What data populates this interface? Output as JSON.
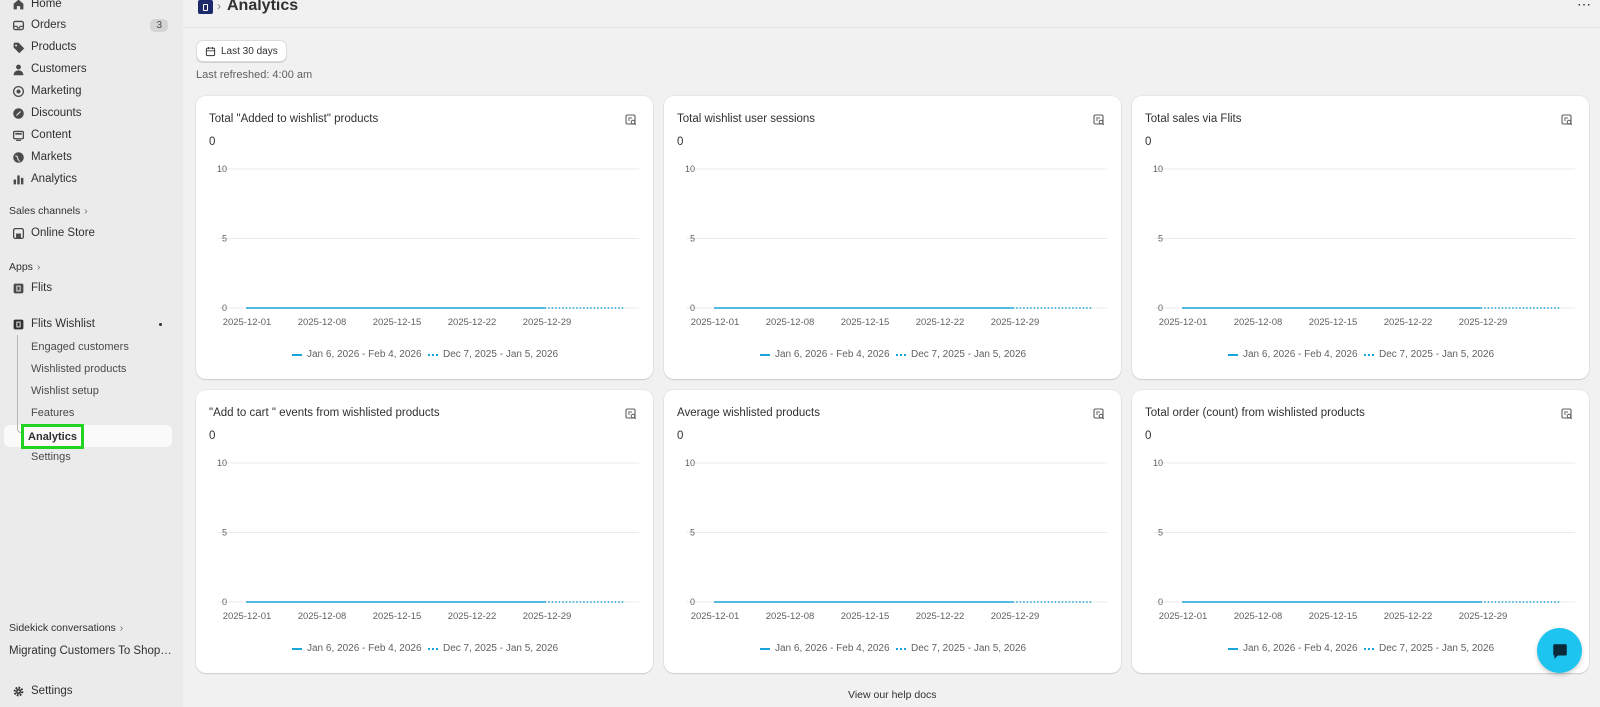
{
  "sidebar": {
    "items": [
      {
        "label": "Home",
        "icon": "home-icon"
      },
      {
        "label": "Orders",
        "icon": "orders-icon",
        "badge": "3"
      },
      {
        "label": "Products",
        "icon": "tag-icon"
      },
      {
        "label": "Customers",
        "icon": "person-icon"
      },
      {
        "label": "Marketing",
        "icon": "target-icon"
      },
      {
        "label": "Discounts",
        "icon": "discount-icon"
      },
      {
        "label": "Content",
        "icon": "content-icon"
      },
      {
        "label": "Markets",
        "icon": "globe-icon"
      },
      {
        "label": "Analytics",
        "icon": "bar-chart-icon"
      }
    ],
    "sales_channels_label": "Sales channels",
    "online_store_label": "Online Store",
    "apps_label": "Apps",
    "flits_label": "Flits",
    "flits_wishlist_label": "Flits Wishlist",
    "sub_items": [
      "Engaged customers",
      "Wishlisted products",
      "Wishlist setup",
      "Features",
      "Analytics",
      "Settings"
    ],
    "sidekick_label": "Sidekick conversations",
    "conversation_label": "Migrating Customers To Shopi...",
    "settings_label": "Settings"
  },
  "header": {
    "title": "Analytics",
    "more": "⋯"
  },
  "filters": {
    "date_range": "Last 30 days",
    "last_refreshed": "Last refreshed: 4:00 am"
  },
  "legend": {
    "current": "Jan 6, 2026 - Feb 4, 2026",
    "previous": "Dec 7, 2025 - Jan 5, 2026"
  },
  "cards": [
    {
      "title": "Total \"Added to wishlist\" products",
      "total": "0"
    },
    {
      "title": "Total wishlist user sessions",
      "total": "0"
    },
    {
      "title": "Total sales via Flits",
      "total": "0"
    },
    {
      "title": "\"Add to cart \" events from wishlisted products",
      "total": "0"
    },
    {
      "title": "Average wishlisted products",
      "total": "0"
    },
    {
      "title": "Total order (count) from wishlisted products",
      "total": "0"
    }
  ],
  "chart_data": [
    {
      "type": "line",
      "title": "Total \"Added to wishlist\" products",
      "x_ticks": [
        "2025-12-01",
        "2025-12-08",
        "2025-12-15",
        "2025-12-22",
        "2025-12-29"
      ],
      "y_ticks": [
        "0",
        "5",
        "10"
      ],
      "ylim": [
        0,
        10
      ],
      "series": [
        {
          "name": "Jan 6, 2026 - Feb 4, 2026",
          "style": "solid",
          "values": [
            0,
            0,
            0,
            0,
            0,
            0,
            0,
            0,
            0,
            0,
            0,
            0,
            0,
            0,
            0,
            0,
            0,
            0,
            0,
            0,
            0,
            0,
            0,
            0,
            0,
            0,
            0,
            0,
            0,
            0
          ]
        },
        {
          "name": "Dec 7, 2025 - Jan 5, 2026",
          "style": "dotted",
          "values": [
            0,
            0,
            0,
            0,
            0,
            0,
            0,
            0,
            0,
            0,
            0,
            0,
            0,
            0,
            0,
            0,
            0,
            0,
            0,
            0,
            0,
            0,
            0,
            0,
            0,
            0,
            0,
            0,
            0,
            0
          ]
        }
      ],
      "grid": true,
      "color": "#1ba4d9"
    },
    {
      "type": "line",
      "title": "Total wishlist user sessions",
      "x_ticks": [
        "2025-12-01",
        "2025-12-08",
        "2025-12-15",
        "2025-12-22",
        "2025-12-29"
      ],
      "y_ticks": [
        "0",
        "5",
        "10"
      ],
      "ylim": [
        0,
        10
      ],
      "series": [
        {
          "name": "Jan 6, 2026 - Feb 4, 2026",
          "style": "solid",
          "values": [
            0,
            0,
            0,
            0,
            0,
            0,
            0,
            0,
            0,
            0,
            0,
            0,
            0,
            0,
            0,
            0,
            0,
            0,
            0,
            0,
            0,
            0,
            0,
            0,
            0,
            0,
            0,
            0,
            0,
            0
          ]
        },
        {
          "name": "Dec 7, 2025 - Jan 5, 2026",
          "style": "dotted",
          "values": [
            0,
            0,
            0,
            0,
            0,
            0,
            0,
            0,
            0,
            0,
            0,
            0,
            0,
            0,
            0,
            0,
            0,
            0,
            0,
            0,
            0,
            0,
            0,
            0,
            0,
            0,
            0,
            0,
            0,
            0
          ]
        }
      ],
      "grid": true,
      "color": "#1ba4d9"
    },
    {
      "type": "line",
      "title": "Total sales via Flits",
      "x_ticks": [
        "2025-12-01",
        "2025-12-08",
        "2025-12-15",
        "2025-12-22",
        "2025-12-29"
      ],
      "y_ticks": [
        "0",
        "5",
        "10"
      ],
      "ylim": [
        0,
        10
      ],
      "series": [
        {
          "name": "Jan 6, 2026 - Feb 4, 2026",
          "style": "solid",
          "values": [
            0,
            0,
            0,
            0,
            0,
            0,
            0,
            0,
            0,
            0,
            0,
            0,
            0,
            0,
            0,
            0,
            0,
            0,
            0,
            0,
            0,
            0,
            0,
            0,
            0,
            0,
            0,
            0,
            0,
            0
          ]
        },
        {
          "name": "Dec 7, 2025 - Jan 5, 2026",
          "style": "dotted",
          "values": [
            0,
            0,
            0,
            0,
            0,
            0,
            0,
            0,
            0,
            0,
            0,
            0,
            0,
            0,
            0,
            0,
            0,
            0,
            0,
            0,
            0,
            0,
            0,
            0,
            0,
            0,
            0,
            0,
            0,
            0
          ]
        }
      ],
      "grid": true,
      "color": "#1ba4d9"
    },
    {
      "type": "line",
      "title": "\"Add to cart \" events from wishlisted products",
      "x_ticks": [
        "2025-12-01",
        "2025-12-08",
        "2025-12-15",
        "2025-12-22",
        "2025-12-29"
      ],
      "y_ticks": [
        "0",
        "5",
        "10"
      ],
      "ylim": [
        0,
        10
      ],
      "series": [
        {
          "name": "Jan 6, 2026 - Feb 4, 2026",
          "style": "solid",
          "values": [
            0,
            0,
            0,
            0,
            0,
            0,
            0,
            0,
            0,
            0,
            0,
            0,
            0,
            0,
            0,
            0,
            0,
            0,
            0,
            0,
            0,
            0,
            0,
            0,
            0,
            0,
            0,
            0,
            0,
            0
          ]
        },
        {
          "name": "Dec 7, 2025 - Jan 5, 2026",
          "style": "dotted",
          "values": [
            0,
            0,
            0,
            0,
            0,
            0,
            0,
            0,
            0,
            0,
            0,
            0,
            0,
            0,
            0,
            0,
            0,
            0,
            0,
            0,
            0,
            0,
            0,
            0,
            0,
            0,
            0,
            0,
            0,
            0
          ]
        }
      ],
      "grid": true,
      "color": "#1ba4d9"
    },
    {
      "type": "line",
      "title": "Average wishlisted products",
      "x_ticks": [
        "2025-12-01",
        "2025-12-08",
        "2025-12-15",
        "2025-12-22",
        "2025-12-29"
      ],
      "y_ticks": [
        "0",
        "5",
        "10"
      ],
      "ylim": [
        0,
        10
      ],
      "series": [
        {
          "name": "Jan 6, 2026 - Feb 4, 2026",
          "style": "solid",
          "values": [
            0,
            0,
            0,
            0,
            0,
            0,
            0,
            0,
            0,
            0,
            0,
            0,
            0,
            0,
            0,
            0,
            0,
            0,
            0,
            0,
            0,
            0,
            0,
            0,
            0,
            0,
            0,
            0,
            0,
            0
          ]
        },
        {
          "name": "Dec 7, 2025 - Jan 5, 2026",
          "style": "dotted",
          "values": [
            0,
            0,
            0,
            0,
            0,
            0,
            0,
            0,
            0,
            0,
            0,
            0,
            0,
            0,
            0,
            0,
            0,
            0,
            0,
            0,
            0,
            0,
            0,
            0,
            0,
            0,
            0,
            0,
            0,
            0
          ]
        }
      ],
      "grid": true,
      "color": "#1ba4d9"
    },
    {
      "type": "line",
      "title": "Total order (count) from wishlisted products",
      "x_ticks": [
        "2025-12-01",
        "2025-12-08",
        "2025-12-15",
        "2025-12-22",
        "2025-12-29"
      ],
      "y_ticks": [
        "0",
        "5",
        "10"
      ],
      "ylim": [
        0,
        10
      ],
      "series": [
        {
          "name": "Jan 6, 2026 - Feb 4, 2026",
          "style": "solid",
          "values": [
            0,
            0,
            0,
            0,
            0,
            0,
            0,
            0,
            0,
            0,
            0,
            0,
            0,
            0,
            0,
            0,
            0,
            0,
            0,
            0,
            0,
            0,
            0,
            0,
            0,
            0,
            0,
            0,
            0,
            0
          ]
        },
        {
          "name": "Dec 7, 2025 - Jan 5, 2026",
          "style": "dotted",
          "values": [
            0,
            0,
            0,
            0,
            0,
            0,
            0,
            0,
            0,
            0,
            0,
            0,
            0,
            0,
            0,
            0,
            0,
            0,
            0,
            0,
            0,
            0,
            0,
            0,
            0,
            0,
            0,
            0,
            0,
            0
          ]
        }
      ],
      "grid": true,
      "color": "#1ba4d9"
    }
  ],
  "footer": {
    "help_link": "View our help docs"
  },
  "colors": {
    "accent": "#1ba4d9",
    "fab": "#1ec4f0",
    "highlight": "#22d322"
  }
}
